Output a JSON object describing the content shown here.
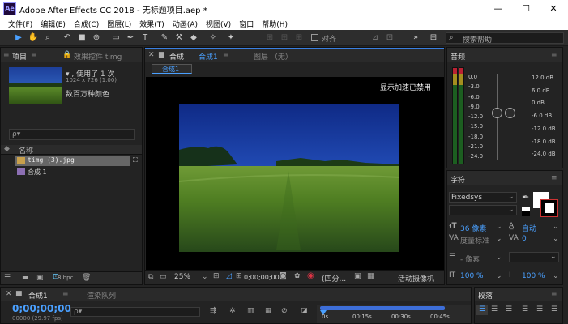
{
  "window": {
    "title": "Adobe After Effects CC 2018 - 无标题项目.aep *",
    "logo": "Ae",
    "minimize": "—",
    "maximize": "☐",
    "close": "✕"
  },
  "menu": [
    "文件(F)",
    "编辑(E)",
    "合成(C)",
    "图层(L)",
    "效果(T)",
    "动画(A)",
    "视图(V)",
    "窗口",
    "帮助(H)"
  ],
  "toolbar": {
    "snap_label": "对齐",
    "search_placeholder": "搜索帮助",
    "icons": [
      "selection-tool-icon",
      "hand-tool-icon",
      "zoom-tool-icon",
      "rotate-tool-icon",
      "camera-tool-icon",
      "pan-behind-icon",
      "rectangle-tool-icon",
      "pen-tool-icon",
      "type-tool-icon",
      "brush-tool-icon",
      "clone-stamp-icon",
      "eraser-tool-icon",
      "roto-brush-icon",
      "puppet-pin-icon"
    ]
  },
  "project": {
    "tab": "项目",
    "effects_tab": "效果控件 timg",
    "info_line1": "▾ , 使用了 1 次",
    "info_line2": "1024 x 726 (1.00)",
    "info_line3": "数百万种颜色",
    "search_placeholder": "ρ▾",
    "column_name": "名称",
    "items": [
      {
        "name": "timg (3).jpg",
        "selected": true
      },
      {
        "name": "合成 1",
        "selected": false
      }
    ],
    "bpc": "8 bpc"
  },
  "composition": {
    "tab_prefix": "合成",
    "tab_name": "合成1",
    "layer_tab": "图层 （无）",
    "breadcrumb": "合成1",
    "accel_text": "显示加速已禁用",
    "zoom": "25%",
    "timecode": "0;00;00;00",
    "resolution": "(四分...",
    "active_camera": "活动摄像机"
  },
  "audio": {
    "title": "音频",
    "db_left": [
      "0.0",
      "-3.0",
      "-6.0",
      "-9.0",
      "-12.0",
      "-15.0",
      "-18.0",
      "-21.0",
      "-24.0"
    ],
    "db_right": [
      "12.0 dB",
      "6.0 dB",
      "0 dB",
      "-6.0 dB",
      "-12.0 dB",
      "-18.0 dB",
      "-24.0 dB"
    ]
  },
  "character": {
    "title": "字符",
    "font": "Fixedsys",
    "size": "36 像素",
    "size_mode": "自动",
    "metric": "度量标准",
    "metric_val": "0",
    "stroke": "- 像素",
    "scale_v": "100 %",
    "scale_h": "100 %"
  },
  "paragraph": {
    "title": "段落"
  },
  "timeline": {
    "tab": "合成1",
    "render_queue": "渲染队列",
    "timecode": "0;00;00;00",
    "fps": "00000 (29.97 fps)",
    "search_placeholder": "ρ▾",
    "ticks": [
      "0s",
      "00:15s",
      "00:30s",
      "00:45s"
    ]
  }
}
